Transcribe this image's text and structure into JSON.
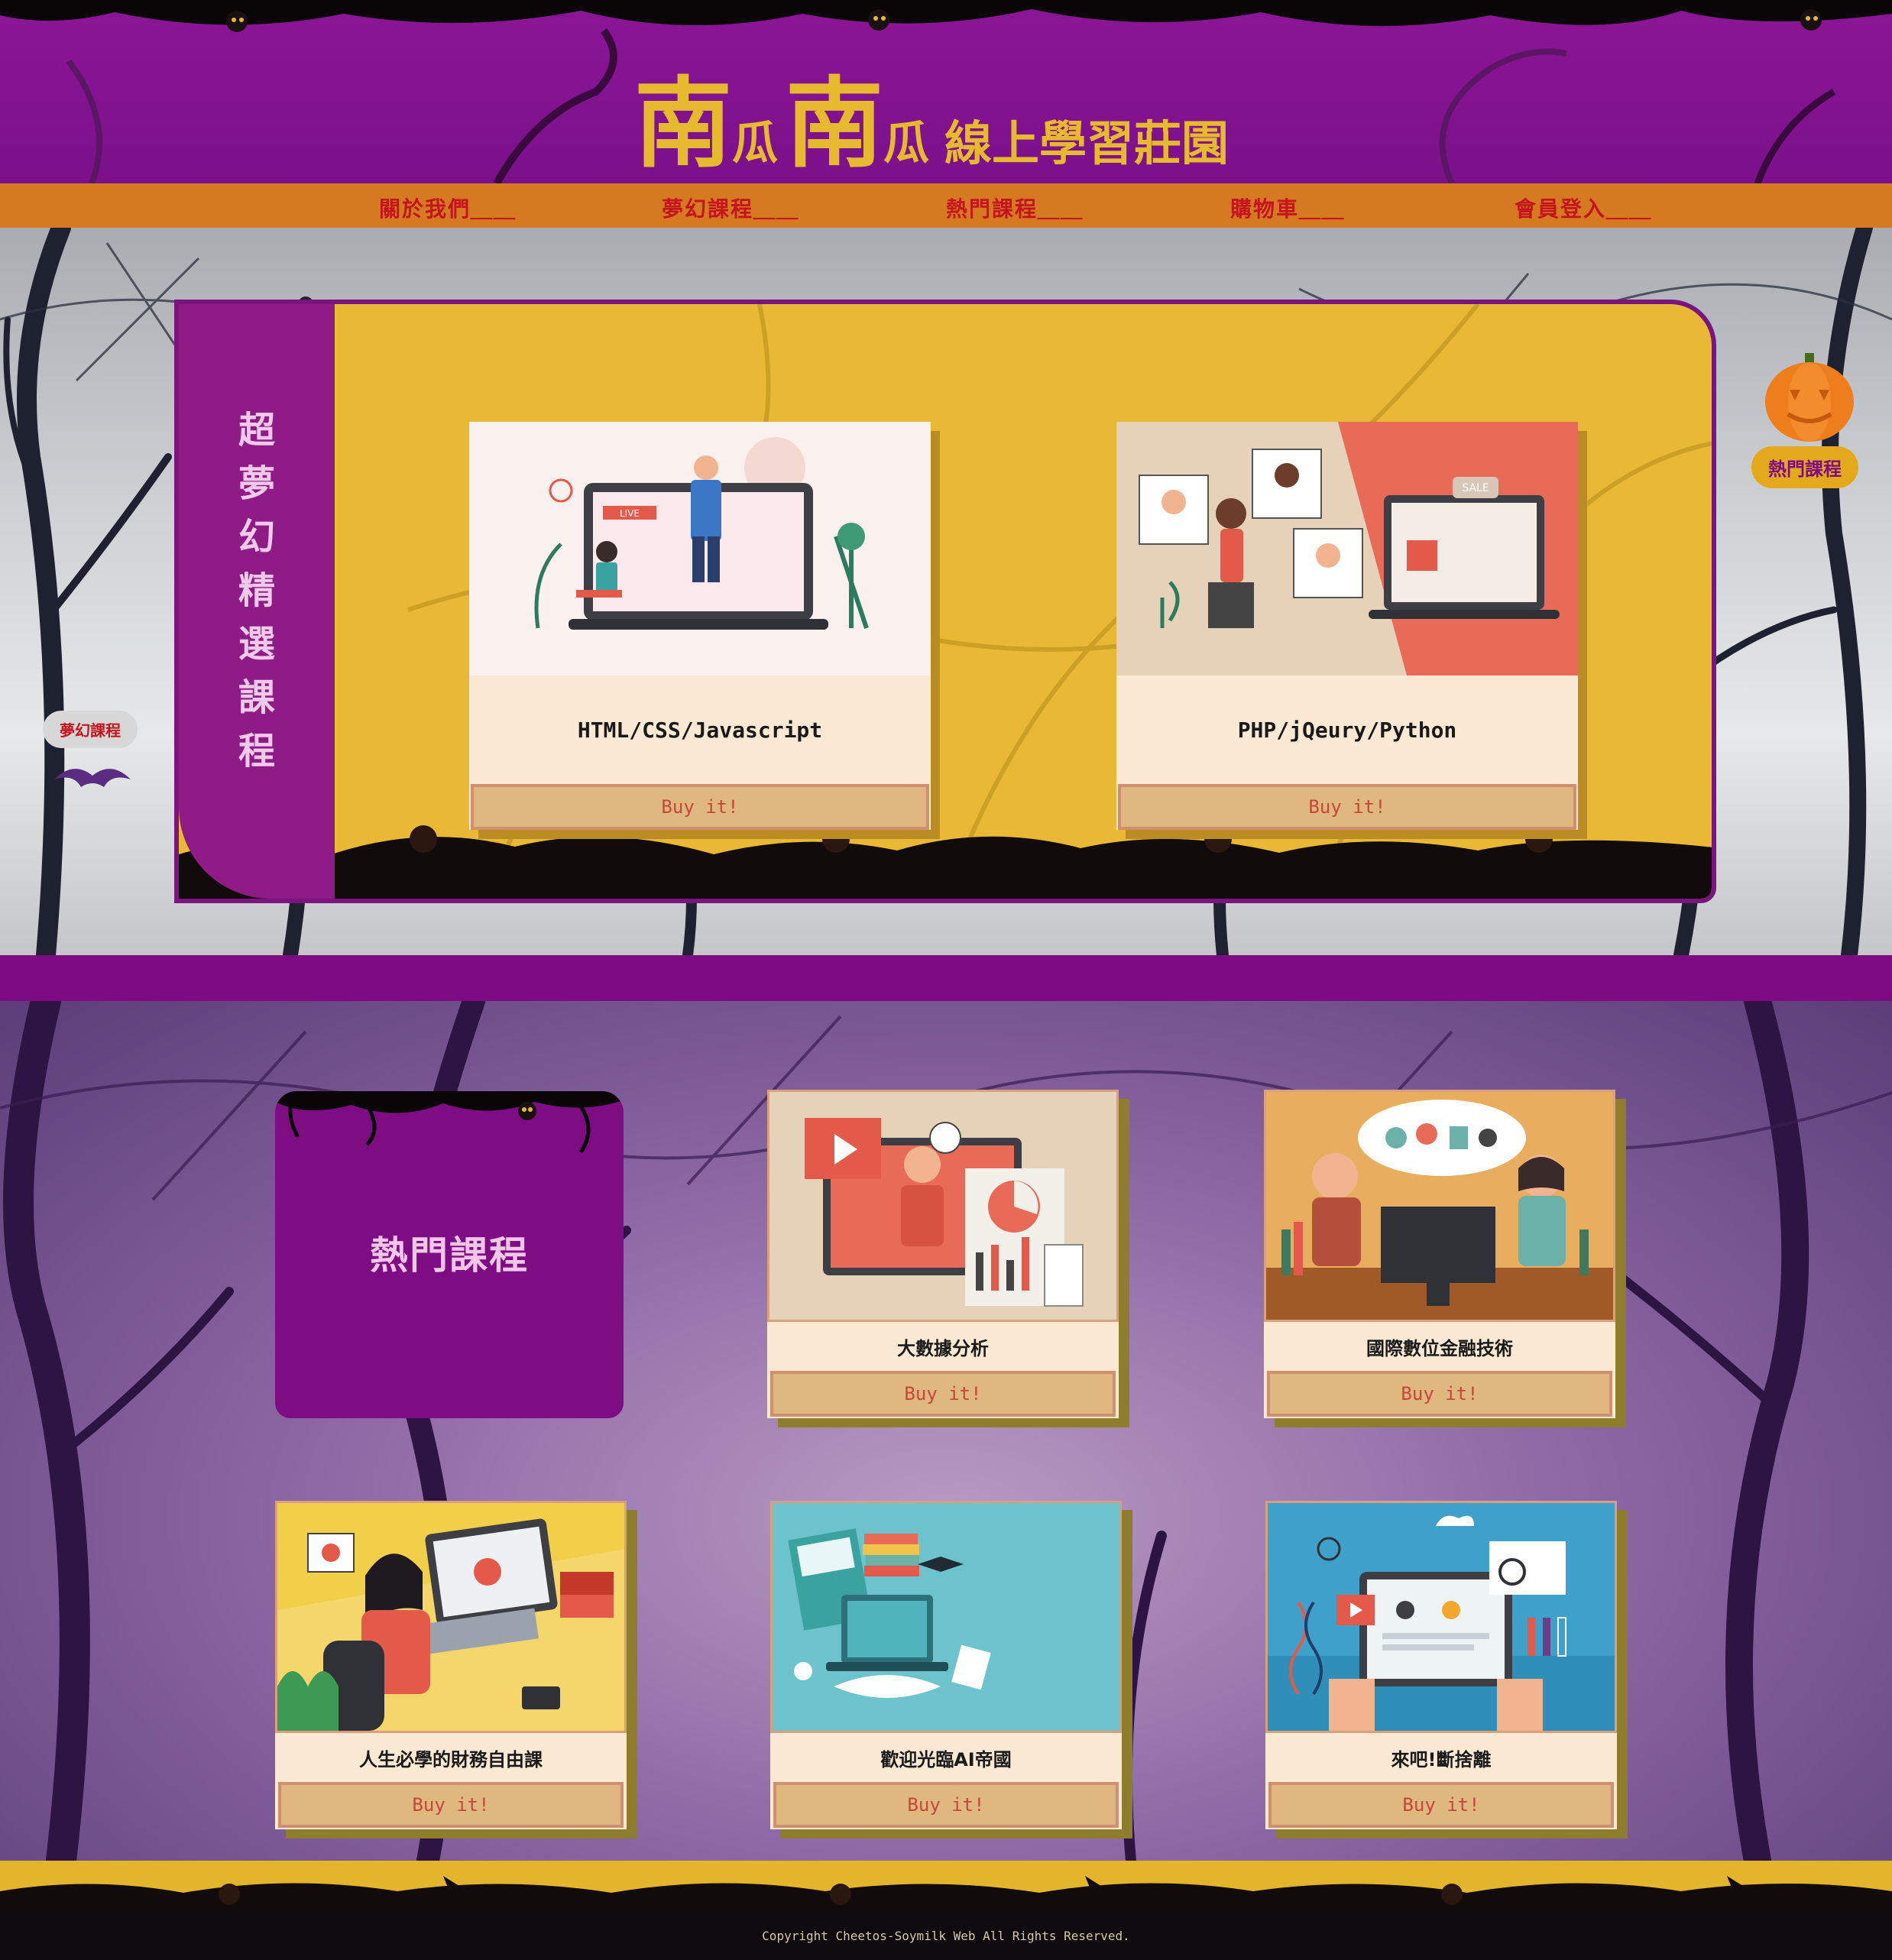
{
  "header": {
    "title_part1": "南",
    "title_part2": "瓜",
    "title_part3": "南",
    "title_part4": "瓜",
    "title_rest": "線上學習莊園",
    "colors": {
      "bg": "#8c1696",
      "title": "#e6b92e",
      "nav": "#d67a22",
      "nav_text": "#c4141c"
    }
  },
  "nav": {
    "items": [
      {
        "label": "關於我們＿＿"
      },
      {
        "label": "夢幻課程＿＿"
      },
      {
        "label": "熱門課程＿＿"
      },
      {
        "label": "購物車＿＿"
      },
      {
        "label": "會員登入＿＿"
      }
    ]
  },
  "featured": {
    "side_title_chars": [
      "超",
      "夢",
      "幻",
      "精",
      "選",
      "課",
      "程"
    ],
    "cards": [
      {
        "title": "HTML/CSS/Javascript",
        "buy_label": "Buy it!",
        "image": "online-live-class-illustration"
      },
      {
        "title": "PHP/jQeury/Python",
        "buy_label": "Buy it!",
        "image": "ecommerce-video-call-illustration"
      }
    ],
    "sale_tag": "SALE",
    "live_tag": "LIVE"
  },
  "floating": {
    "left_badge": "夢幻課程",
    "right_badge": "熱門課程"
  },
  "hot": {
    "title": "熱門課程",
    "cards": [
      {
        "title": "大數據分析",
        "buy_label": "Buy it!",
        "image": "video-presentation-illustration"
      },
      {
        "title": "國際數位金融技術",
        "buy_label": "Buy it!",
        "image": "students-computer-illustration"
      },
      {
        "title": "人生必學的財務自由課",
        "buy_label": "Buy it!",
        "image": "woman-laptop-illustration"
      },
      {
        "title": "歡迎光臨AI帝國",
        "buy_label": "Buy it!",
        "image": "laptop-books-illustration"
      },
      {
        "title": "來吧!斷捨離",
        "buy_label": "Buy it!",
        "image": "tablet-science-illustration"
      }
    ]
  },
  "footer": {
    "copyright": "Copyright Cheetos-Soymilk Web All Rights Reserved."
  }
}
